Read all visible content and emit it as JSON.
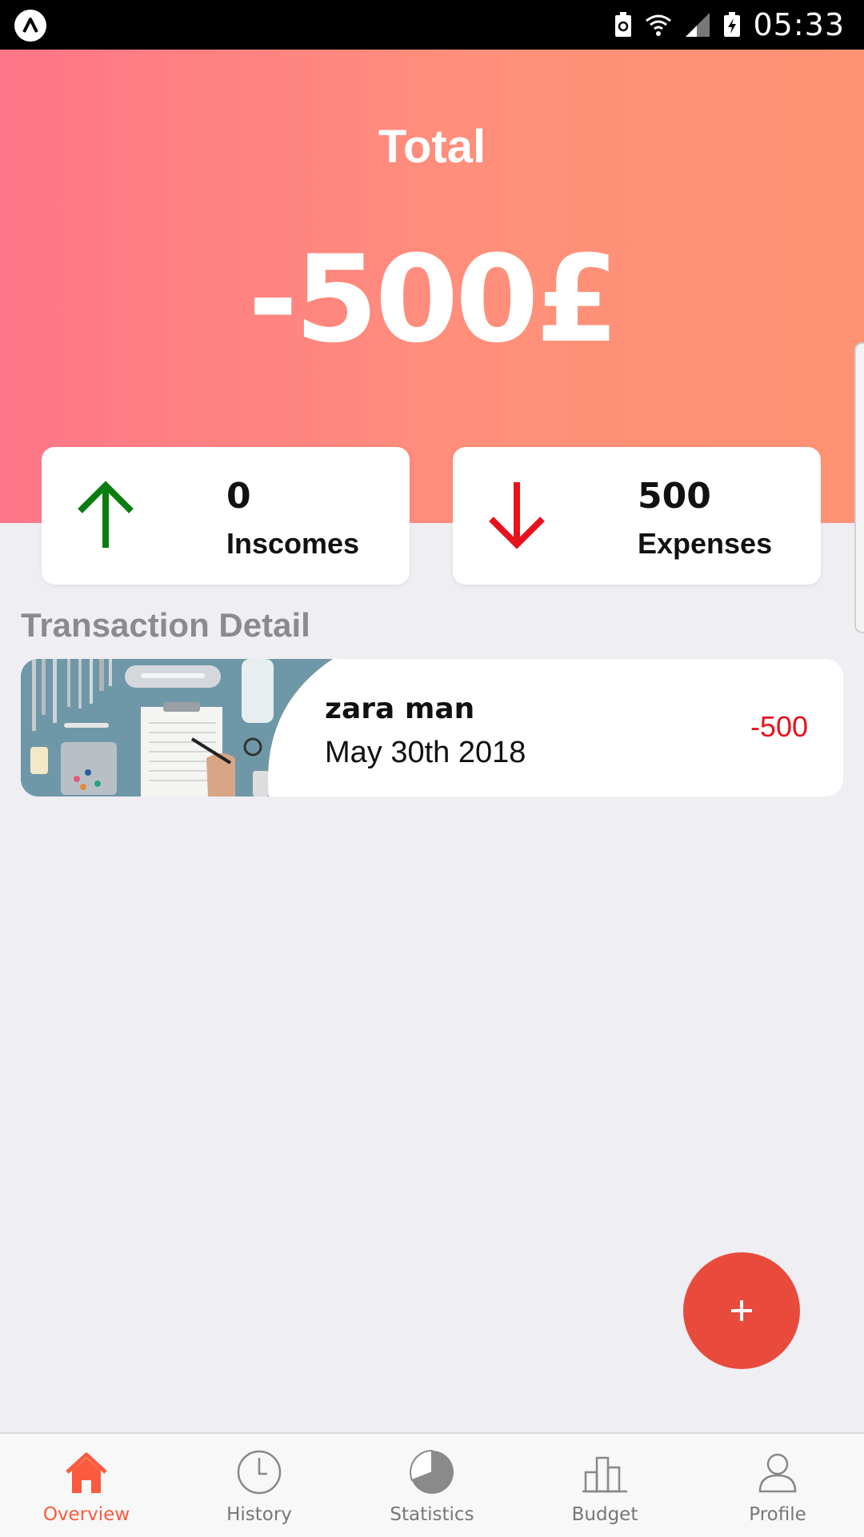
{
  "status_bar": {
    "time": "05:33",
    "icons": [
      "app-a-icon",
      "battery-saver-icon",
      "wifi-icon",
      "signal-icon",
      "battery-charging-icon"
    ]
  },
  "header": {
    "total_label": "Total",
    "total_amount": "-500£",
    "gradient": [
      "#fe7689",
      "#ff9374"
    ]
  },
  "summary": {
    "income": {
      "value": "0",
      "label": "Inscomes",
      "icon": "arrow-up-icon",
      "color": "#0a7d10"
    },
    "expense": {
      "value": "500",
      "label": "Expenses",
      "icon": "arrow-down-icon",
      "color": "#e8121c"
    }
  },
  "transactions_section": {
    "title": "Transaction Detail",
    "items": [
      {
        "title": "zara man",
        "date": "May 30th 2018",
        "amount": "-500",
        "image": "medical-tools-photo"
      }
    ]
  },
  "fab": {
    "label": "+",
    "color": "#e84b3c"
  },
  "bottom_nav": {
    "active_color": "#fa5a3d",
    "items": [
      {
        "label": "Overview",
        "icon": "home-icon",
        "active": true
      },
      {
        "label": "History",
        "icon": "clock-icon",
        "active": false
      },
      {
        "label": "Statistics",
        "icon": "pie-chart-icon",
        "active": false
      },
      {
        "label": "Budget",
        "icon": "bar-chart-icon",
        "active": false
      },
      {
        "label": "Profile",
        "icon": "person-icon",
        "active": false
      }
    ]
  }
}
